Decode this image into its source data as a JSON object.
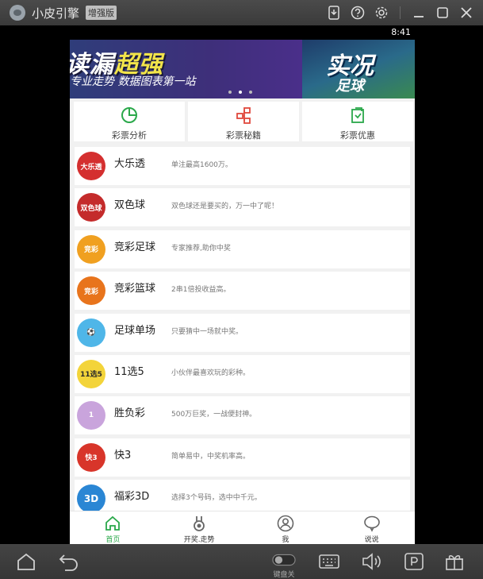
{
  "window": {
    "title": "小皮引擎",
    "badge": "增强版"
  },
  "status": {
    "time": "8:41"
  },
  "banner": {
    "slide1_big_a": "读漏",
    "slide1_big_b": "超强",
    "slide1_sub": "专业走势 数据图表第一站",
    "slide2_big": "实况",
    "slide2_sub": "足球"
  },
  "quick": [
    {
      "label": "彩票分析",
      "icon": "pie-chart-icon"
    },
    {
      "label": "彩票秘籍",
      "icon": "network-icon"
    },
    {
      "label": "彩票优惠",
      "icon": "bag-icon"
    }
  ],
  "lotteries": [
    {
      "name": "大乐透",
      "desc": "单注最高1600万。",
      "color": "#d42f2f",
      "icon_text": "大乐透"
    },
    {
      "name": "双色球",
      "desc": "双色球还是要买的，万一中了呢！",
      "color": "#c42b2b",
      "icon_text": "双色球"
    },
    {
      "name": "竞彩足球",
      "desc": "专家推荐,助你中奖",
      "color": "#f0a020",
      "icon_text": "竞彩"
    },
    {
      "name": "竞彩篮球",
      "desc": "2串1倍投收益高。",
      "color": "#e8741c",
      "icon_text": "竞彩"
    },
    {
      "name": "足球单场",
      "desc": "只要猜中一场就中奖。",
      "color": "#4fb6e8",
      "icon_text": "⚽"
    },
    {
      "name": "11选5",
      "desc": "小伙伴最喜欢玩的彩种。",
      "color": "#f3d43a",
      "icon_text": "11选5"
    },
    {
      "name": "胜负彩",
      "desc": "500万巨奖，一战便封神。",
      "color": "#c9a4dc",
      "icon_text": "1"
    },
    {
      "name": "快3",
      "desc": "简单易中，中奖机率高。",
      "color": "#d8352a",
      "icon_text": "快3"
    },
    {
      "name": "福彩3D",
      "desc": "选择3个号码，选中中千元。",
      "color": "#2a86d4",
      "icon_text": "3D"
    }
  ],
  "tabs": [
    {
      "label": "首页",
      "icon": "home-icon",
      "active": true
    },
    {
      "label": "开奖.走势",
      "icon": "medal-icon",
      "active": false
    },
    {
      "label": "我",
      "icon": "user-icon",
      "active": false
    },
    {
      "label": "说说",
      "icon": "chat-icon",
      "active": false
    }
  ],
  "bottombar": {
    "keyboard_label": "键盘关"
  },
  "colors": {
    "accent": "#2aa84a",
    "quick_icon": "#2aa84a"
  }
}
